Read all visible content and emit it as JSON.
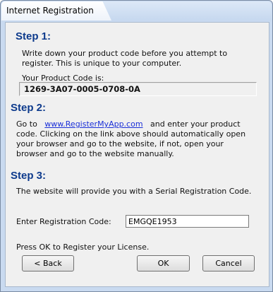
{
  "window": {
    "title": "Internet Registration"
  },
  "step1": {
    "title": "Step 1:",
    "line1": "Write down your product code before you attempt to",
    "line2": "register.  This is unique to your computer.",
    "code_label": "Your Product Code is:",
    "product_code": "1269-3A07-0005-0708-0A"
  },
  "step2": {
    "title": "Step 2:",
    "line1_prefix": "Go to",
    "link": "www.RegisterMyApp.com",
    "line1_suffix": "and enter your product",
    "line2": "code.  Clicking on the link above should automatically open",
    "line3": "your browser and go to the website, if not, open your",
    "line4": "browser and go to the website manually."
  },
  "step3": {
    "title": "Step 3:",
    "line1": "The website will provide you with a Serial Registration Code.",
    "reg_label": "Enter Registration Code:",
    "reg_value": "EMGQE1953",
    "press_ok": "Press OK to Register your License."
  },
  "buttons": {
    "back": "< Back",
    "ok": "OK",
    "cancel": "Cancel"
  }
}
